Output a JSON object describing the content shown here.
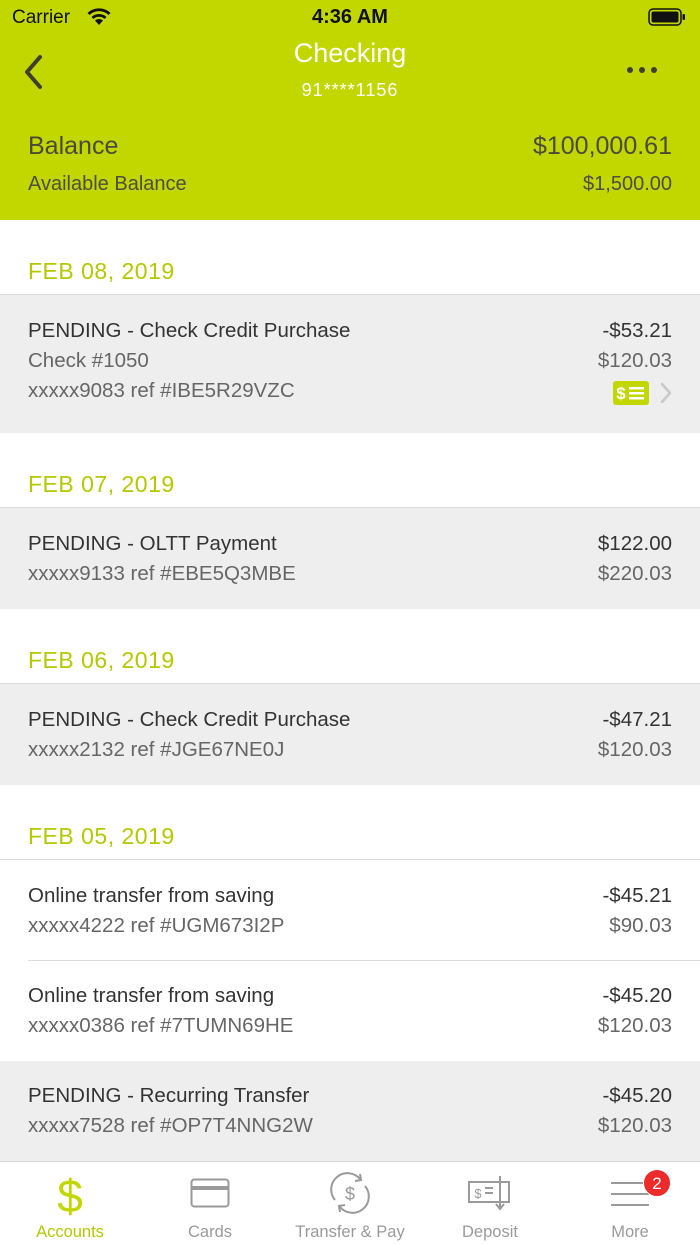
{
  "status_bar": {
    "carrier": "Carrier",
    "time": "4:36 AM"
  },
  "header": {
    "title": "Checking",
    "account_number": "91****1156"
  },
  "balance": {
    "balance_label": "Balance",
    "balance_value": "$100,000.61",
    "available_label": "Available Balance",
    "available_value": "$1,500.00"
  },
  "groups": [
    {
      "date": "FEB 08, 2019",
      "transactions": [
        {
          "title": "PENDING - Check Credit Purchase",
          "check": "Check #1050",
          "ref": "xxxxx9083 ref #IBE5R29VZC",
          "amount": "-$53.21",
          "balance": "$120.03"
        }
      ]
    },
    {
      "date": "FEB 07, 2019",
      "transactions": [
        {
          "title": "PENDING - OLTT Payment",
          "ref": "xxxxx9133 ref #EBE5Q3MBE",
          "amount": "$122.00",
          "balance": "$220.03"
        }
      ]
    },
    {
      "date": "FEB 06, 2019",
      "transactions": [
        {
          "title": "PENDING - Check Credit Purchase",
          "ref": "xxxxx2132 ref #JGE67NE0J",
          "amount": "-$47.21",
          "balance": "$120.03"
        }
      ]
    },
    {
      "date": "FEB 05, 2019",
      "transactions": [
        {
          "title": "Online transfer from saving",
          "ref": "xxxxx4222 ref #UGM673I2P",
          "amount": "-$45.21",
          "balance": "$90.03"
        },
        {
          "title": "Online transfer from saving",
          "ref": "xxxxx0386 ref #7TUMN69HE",
          "amount": "-$45.20",
          "balance": "$120.03"
        },
        {
          "title": "PENDING - Recurring Transfer",
          "ref": "xxxxx7528 ref #OP7T4NNG2W",
          "amount": "-$45.20",
          "balance": "$120.03"
        }
      ]
    }
  ],
  "tabs": [
    {
      "label": "Accounts",
      "icon": "dollar-icon",
      "active": true
    },
    {
      "label": "Cards",
      "icon": "card-icon"
    },
    {
      "label": "Transfer & Pay",
      "icon": "transfer-icon"
    },
    {
      "label": "Deposit",
      "icon": "deposit-icon"
    },
    {
      "label": "More",
      "icon": "menu-icon",
      "badge": "2"
    }
  ],
  "colors": {
    "brand": "#c2d600",
    "accent_text": "#b4c800",
    "badge": "#ee2b2b",
    "pending_row": "#eeeeee"
  }
}
